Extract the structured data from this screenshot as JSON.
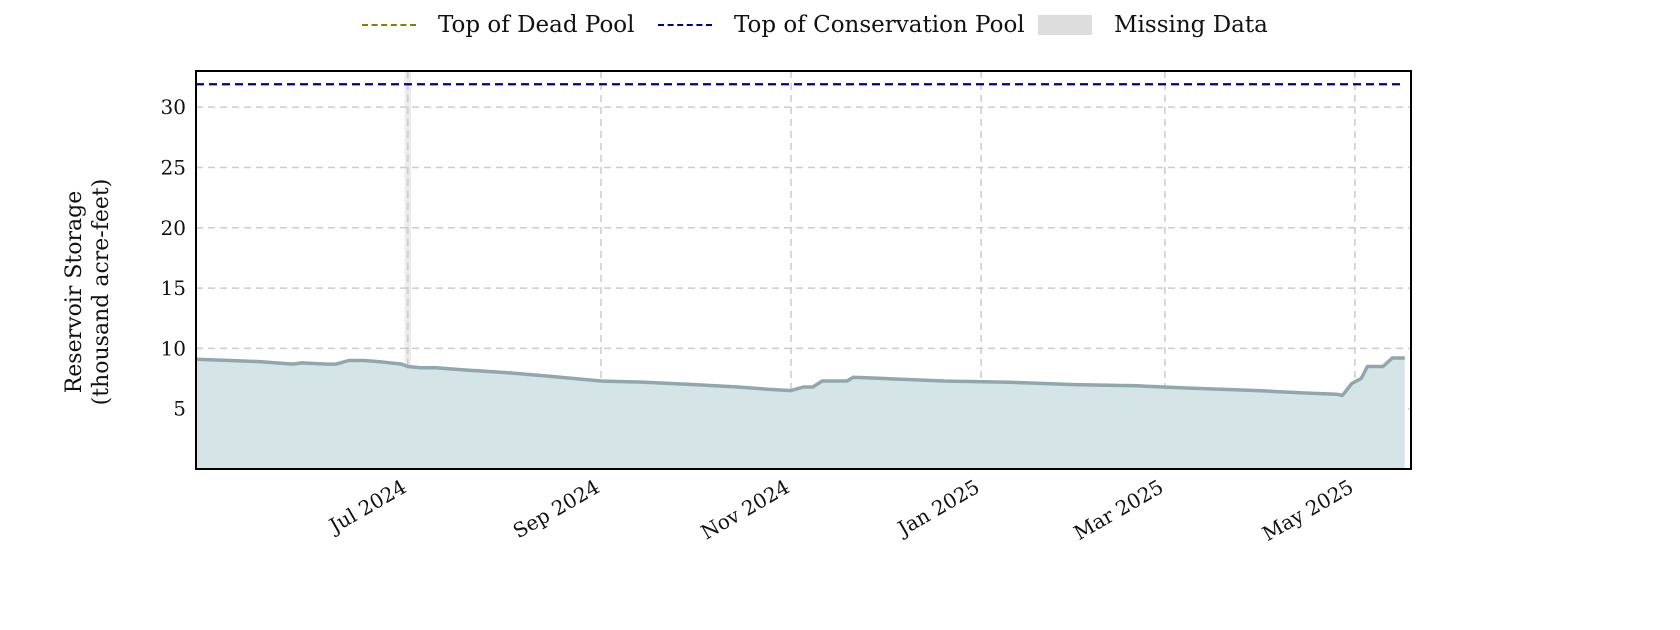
{
  "chart_data": {
    "type": "area",
    "title": "",
    "ylabel_line1": "Reservoir Storage",
    "ylabel_line2": "(thousand acre-feet)",
    "xlabel": "",
    "ylim": [
      0,
      33
    ],
    "xlim": [
      "2024-04-24",
      "2025-05-19"
    ],
    "yticks": [
      5,
      10,
      15,
      20,
      25,
      30
    ],
    "xticks": [
      {
        "date": "2024-07-01",
        "label": "Jul 2024"
      },
      {
        "date": "2024-09-01",
        "label": "Sep 2024"
      },
      {
        "date": "2024-11-01",
        "label": "Nov 2024"
      },
      {
        "date": "2025-01-01",
        "label": "Jan 2025"
      },
      {
        "date": "2025-03-01",
        "label": "Mar 2025"
      },
      {
        "date": "2025-05-01",
        "label": "May 2025"
      }
    ],
    "grid": true,
    "legend_position": "top-center",
    "legend": [
      {
        "label": "Top of Dead Pool",
        "style": "dashed",
        "color": "#8a8000"
      },
      {
        "label": "Top of Conservation Pool",
        "style": "dashed",
        "color": "#00008b"
      },
      {
        "label": "Missing Data",
        "style": "box",
        "color": "#dddddd"
      }
    ],
    "reference_lines": [
      {
        "name": "Top of Conservation Pool",
        "value": 31.9,
        "color": "#00008b"
      }
    ],
    "missing_ranges": [
      [
        "2024-06-30",
        "2024-07-02"
      ]
    ],
    "series": [
      {
        "name": "Reservoir Storage",
        "color": "#8fa8ad",
        "fill": "#d5e4e6",
        "points": [
          [
            "2024-04-24",
            9.1
          ],
          [
            "2024-05-05",
            9.0
          ],
          [
            "2024-05-15",
            8.9
          ],
          [
            "2024-05-25",
            8.7
          ],
          [
            "2024-05-28",
            8.8
          ],
          [
            "2024-06-05",
            8.7
          ],
          [
            "2024-06-08",
            8.7
          ],
          [
            "2024-06-12",
            9.0
          ],
          [
            "2024-06-17",
            9.0
          ],
          [
            "2024-06-22",
            8.9
          ],
          [
            "2024-06-29",
            8.7
          ],
          [
            "2024-07-01",
            8.5
          ],
          [
            "2024-07-05",
            8.4
          ],
          [
            "2024-07-10",
            8.4
          ],
          [
            "2024-07-20",
            8.2
          ],
          [
            "2024-08-01",
            8.0
          ],
          [
            "2024-08-15",
            7.7
          ],
          [
            "2024-09-01",
            7.3
          ],
          [
            "2024-09-15",
            7.2
          ],
          [
            "2024-10-01",
            7.0
          ],
          [
            "2024-10-15",
            6.8
          ],
          [
            "2024-10-25",
            6.6
          ],
          [
            "2024-11-01",
            6.5
          ],
          [
            "2024-11-05",
            6.8
          ],
          [
            "2024-11-08",
            6.8
          ],
          [
            "2024-11-11",
            7.3
          ],
          [
            "2024-11-19",
            7.3
          ],
          [
            "2024-11-21",
            7.6
          ],
          [
            "2024-12-01",
            7.5
          ],
          [
            "2024-12-20",
            7.3
          ],
          [
            "2025-01-10",
            7.2
          ],
          [
            "2025-01-31",
            7.0
          ],
          [
            "2025-02-20",
            6.9
          ],
          [
            "2025-03-10",
            6.7
          ],
          [
            "2025-03-31",
            6.5
          ],
          [
            "2025-04-15",
            6.3
          ],
          [
            "2025-04-25",
            6.2
          ],
          [
            "2025-04-27",
            6.1
          ],
          [
            "2025-04-30",
            7.1
          ],
          [
            "2025-05-03",
            7.5
          ],
          [
            "2025-05-05",
            8.5
          ],
          [
            "2025-05-10",
            8.5
          ],
          [
            "2025-05-13",
            9.2
          ],
          [
            "2025-05-17",
            9.2
          ]
        ]
      }
    ]
  }
}
